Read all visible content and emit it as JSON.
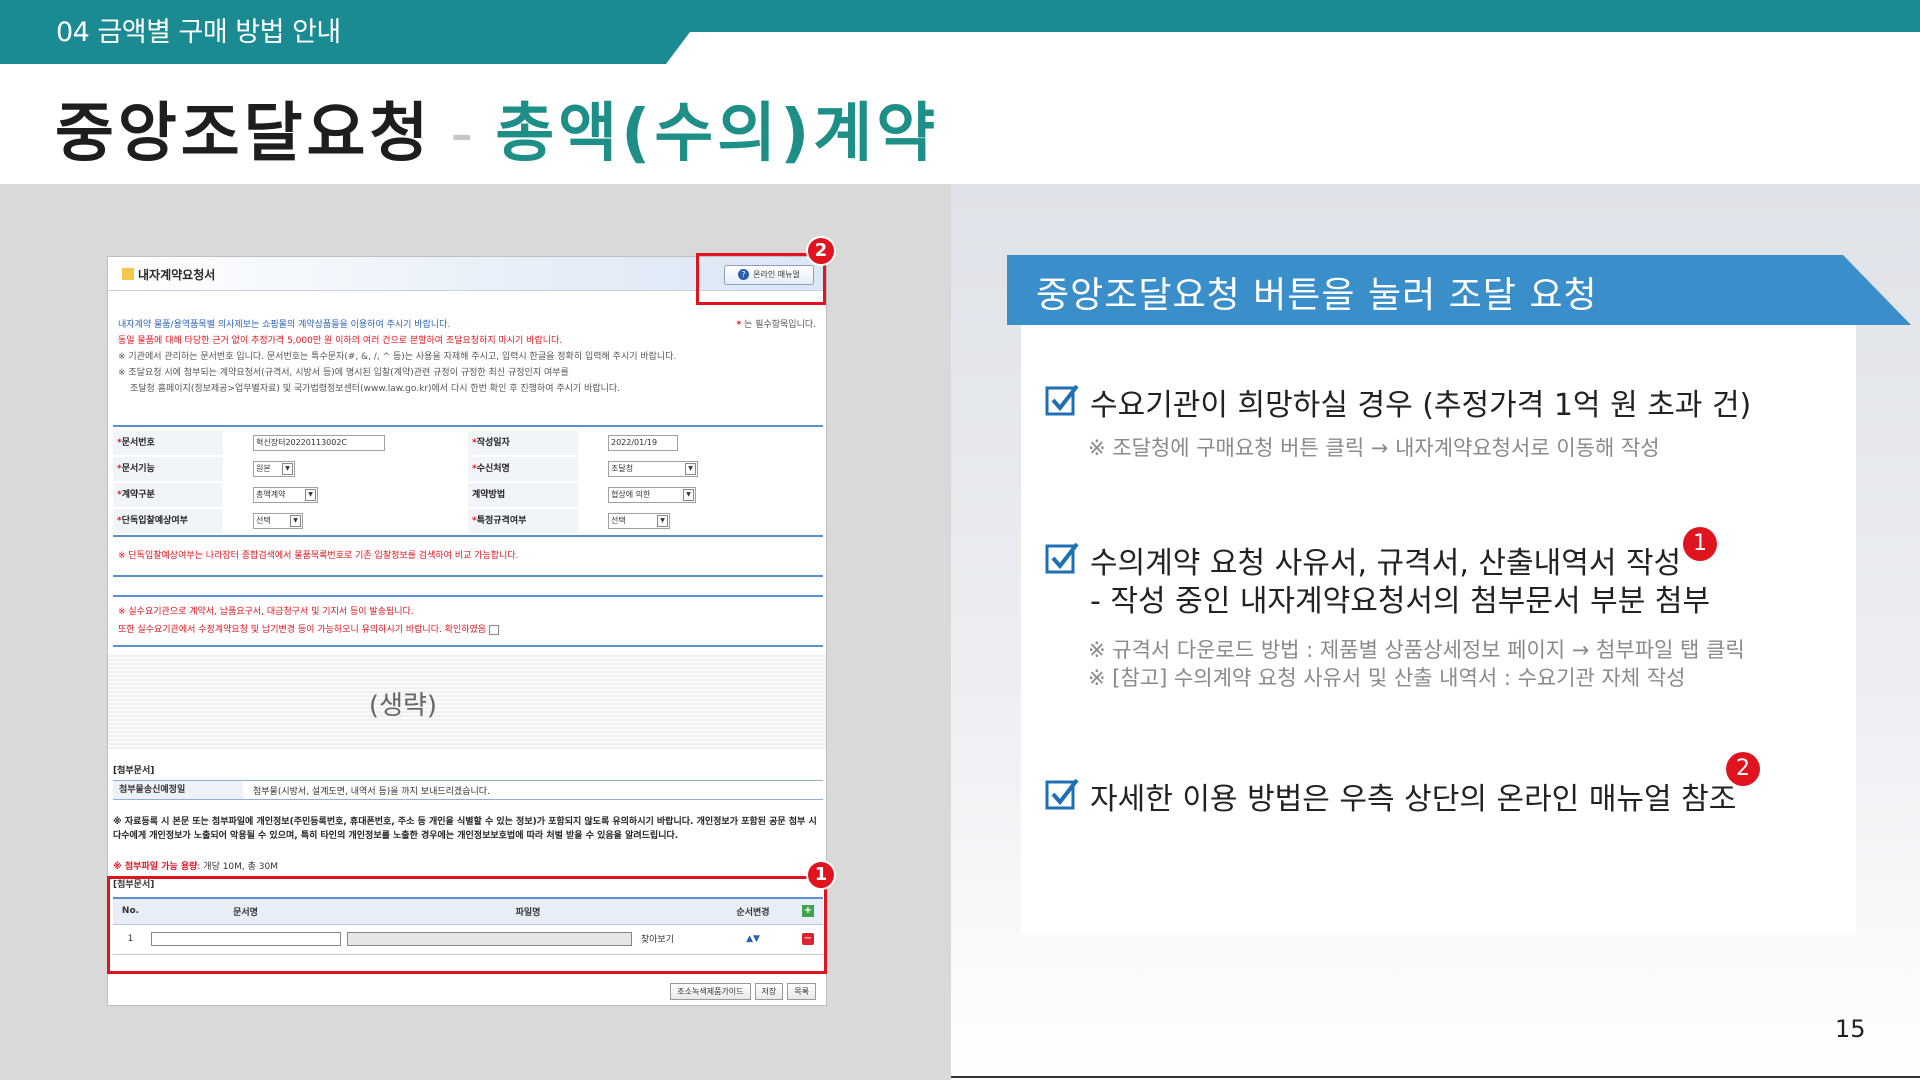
{
  "header": {
    "section_label": "04 금액별 구매 방법 안내",
    "title_main": "중앙조달요청",
    "title_dash": "-",
    "title_sub": "총액(수의)계약"
  },
  "colors": {
    "teal": "#1a8b93",
    "teal_dark": "#1e8f87",
    "banner_blue": "#3a8ec9",
    "badge_red": "#e0141e",
    "check_blue": "#1f6fb5"
  },
  "form": {
    "title": "내자계약요청서",
    "manual_button": "온라인 매뉴얼",
    "required_note": "는 필수항목입니다.",
    "notice_lines": [
      "내자계약 물품/용역품목별 의사제보는 쇼핑몰의 계약상품들을 이용하여 주시기 바랍니다.",
      "동일 물품에 대해 타당한 근거 없이 추정가격 5,000만 원 이하의 여러 건으로 분할하여 조달요청하지 마시기 바랍니다.",
      "※ 기관에서 관리하는 문서번호 입니다. 문서번호는 특수문자(#, &, /, ^ 등)는 사용을 자제해 주시고, 입력시 한글을 정확히 입력해 주시기 바랍니다.",
      "※ 조달요청 시에 첨부되는 계약요청서(규격서, 시방서 등)에 명시된 입찰(계약)관련 규정이 규정한 최신 규정인지 여부를",
      "조달청 홈페이지(정보제공>업무별자료) 및 국가법령정보센터(www.law.go.kr)에서 다시 한번 확인 후 진행하여 주시기 바랍니다."
    ],
    "fields": [
      {
        "label": "문서번호",
        "value": "혁신장터20220113002C"
      },
      {
        "label": "작성일자",
        "value": "2022/01/19"
      },
      {
        "label": "문서기능",
        "value": "원본"
      },
      {
        "label": "수신처명",
        "value": "조달청"
      },
      {
        "label": "계약구분",
        "value": "총액계약"
      },
      {
        "label": "계약방법",
        "value": "협상에 의한"
      },
      {
        "label": "단독입찰예상여부",
        "value": "선택"
      },
      {
        "label": "특정규격여부",
        "value": "선택"
      }
    ],
    "red_note_1": "※ 단독입찰예상여부는 나라장터 종합검색에서 물품목록번호로 기존 입찰정보를 검색하여 비교 가능합니다.",
    "red_note_2a": "※ 실수요기관으로 계약서, 납품요구서, 대금청구서 및 기지서 등이 발송됩니다.",
    "red_note_2b": "또한 실수요기관에서 수정계약요청 및 납기변경 등이 가능하오니 유의하시기 바랍니다. 확인하였음",
    "omitted": "(생략)",
    "attach_head": "[첨부문서]",
    "attach_label": "첨부물송신예정일",
    "attach_text": "첨부물(시방서, 설계도면, 내역서 등)을        까지 보내드리겠습니다.",
    "warn_text": "※ 자료등록 시 본문 또는 첨부파일에 개인정보(주민등록번호, 휴대폰번호, 주소 등 개인을 식별할 수 있는 정보)가 포함되지 않도록 유의하시기 바랍니다. 개인정보가 포함된 공문 첨부 시 다수에게 개인정보가 노출되어 악용될 수 있으며, 특히 타인의 개인정보를 노출한 경우에는 개인정보보호법에 따라 처벌 받을 수 있음을 알려드립니다.",
    "size_label": "※ 첨부파일 가능 용량",
    "size_value": ": 개당 10M, 총 30M",
    "table_label": "[첨부문서]",
    "table_headers": [
      "No.",
      "문서명",
      "파일명",
      "순서변경"
    ],
    "table_row": {
      "no": "1",
      "browse": "찾아보기"
    },
    "bottom_buttons": [
      "조소녹색제품가이드",
      "저장",
      "목록"
    ]
  },
  "right": {
    "banner": "중앙조달요청 버튼을 눌러 조달 요청",
    "items": [
      {
        "main": "수요기관이 희망하실 경우 (추정가격 1억 원 초과 건)",
        "subs": [
          "※ 조달청에 구매요청 버튼 클릭 → 내자계약요청서로 이동해 작성"
        ]
      },
      {
        "main": "수의계약 요청 사유서, 규격서, 산출내역서 작성",
        "main2": "- 작성 중인 내자계약요청서의 첨부문서 부분 첨부",
        "badge": "1",
        "subs": [
          "※ 규격서 다운로드 방법 : 제품별 상품상세정보 페이지 → 첨부파일 탭 클릭",
          "※ [참고] 수의계약 요청 사유서 및 산출 내역서 : 수요기관 자체 작성"
        ]
      },
      {
        "main": "자세한 이용 방법은 우측 상단의 온라인 매뉴얼 참조",
        "badge": "2",
        "subs": []
      }
    ]
  },
  "badges": {
    "one": "1",
    "two": "2"
  },
  "page_number": "15"
}
